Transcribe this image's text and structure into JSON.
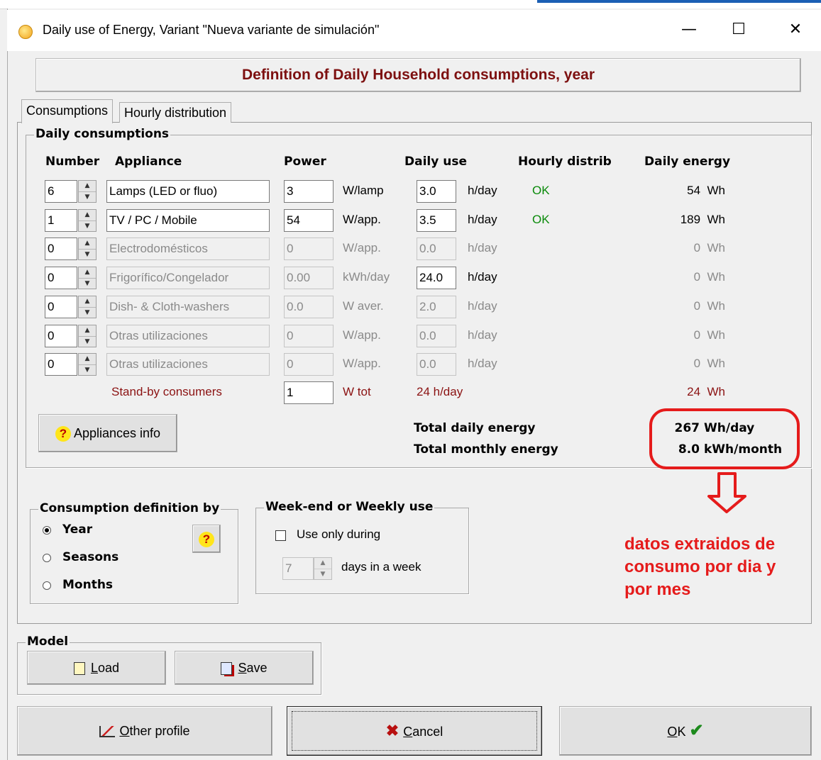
{
  "window": {
    "title": "Daily use of Energy, Variant  \"Nueva variante de simulación\"",
    "min_symbol": "—",
    "max_symbol": "☐",
    "close_symbol": "✕"
  },
  "header_title": "Definition of Daily Household consumptions, year",
  "tabs": [
    {
      "label": "Consumptions"
    },
    {
      "label": "Hourly distribution"
    }
  ],
  "daily_consumptions": {
    "group_label": "Daily consumptions",
    "headers": {
      "number": "Number",
      "appliance": "Appliance",
      "power": "Power",
      "daily_use": "Daily use",
      "hourly_distrib": "Hourly distrib",
      "daily_energy": "Daily energy"
    },
    "rows": [
      {
        "number": "6",
        "appliance": "Lamps (LED or fluo)",
        "power": "3",
        "power_unit": "W/lamp",
        "use": "3.0",
        "use_unit": "h/day",
        "distrib": "OK",
        "energy": "54  Wh",
        "enabled": true
      },
      {
        "number": "1",
        "appliance": "TV / PC / Mobile",
        "power": "54",
        "power_unit": "W/app.",
        "use": "3.5",
        "use_unit": "h/day",
        "distrib": "OK",
        "energy": "189  Wh",
        "enabled": true
      },
      {
        "number": "0",
        "appliance": "Electrodomésticos",
        "power": "0",
        "power_unit": "W/app.",
        "use": "0.0",
        "use_unit": "h/day",
        "distrib": "",
        "energy": "0  Wh",
        "enabled": false
      },
      {
        "number": "0",
        "appliance": "Frigorífico/Congelador",
        "power": "0.00",
        "power_unit": "kWh/day",
        "use": "24.0",
        "use_unit": "h/day",
        "distrib": "",
        "energy": "0  Wh",
        "enabled": false,
        "use_enabled": true
      },
      {
        "number": "0",
        "appliance": "Dish- & Cloth-washers",
        "power": "0.0",
        "power_unit": "W aver.",
        "use": "2.0",
        "use_unit": "h/day",
        "distrib": "",
        "energy": "0  Wh",
        "enabled": false
      },
      {
        "number": "0",
        "appliance": "Otras utilizaciones",
        "power": "0",
        "power_unit": "W/app.",
        "use": "0.0",
        "use_unit": "h/day",
        "distrib": "",
        "energy": "0  Wh",
        "enabled": false
      },
      {
        "number": "0",
        "appliance": "Otras utilizaciones",
        "power": "0",
        "power_unit": "W/app.",
        "use": "0.0",
        "use_unit": "h/day",
        "distrib": "",
        "energy": "0  Wh",
        "enabled": false
      }
    ],
    "standby": {
      "label": "Stand-by consumers",
      "power": "1",
      "unit": "W tot",
      "use": "24 h/day",
      "energy": "24  Wh"
    },
    "appliances_info_label": "Appliances info",
    "total_daily_label": "Total daily energy",
    "total_daily_value": "267",
    "total_daily_unit": "Wh/day",
    "total_monthly_label": "Total monthly energy",
    "total_monthly_value": "8.0",
    "total_monthly_unit": "kWh/month"
  },
  "consumption_definition": {
    "group_label": "Consumption definition by",
    "options": [
      "Year",
      "Seasons",
      "Months"
    ],
    "selected": "Year"
  },
  "weekend": {
    "group_label": "Week-end or Weekly use",
    "checkbox_label": "Use only during",
    "checked": false,
    "days_value": "7",
    "days_label": "days in a week"
  },
  "annotation": {
    "text_lines": [
      "datos extraidos de",
      "consumo por dia y",
      "por mes"
    ],
    "color": "#e51b1b"
  },
  "model": {
    "group_label": "Model",
    "load_prefix": "",
    "load_key": "L",
    "load_rest": "oad",
    "save_key": "S",
    "save_rest": "ave"
  },
  "footer": {
    "other_key": "O",
    "other_rest": "ther profile",
    "cancel_key": "C",
    "cancel_rest": "ancel",
    "ok_key": "O",
    "ok_rest": "K"
  }
}
